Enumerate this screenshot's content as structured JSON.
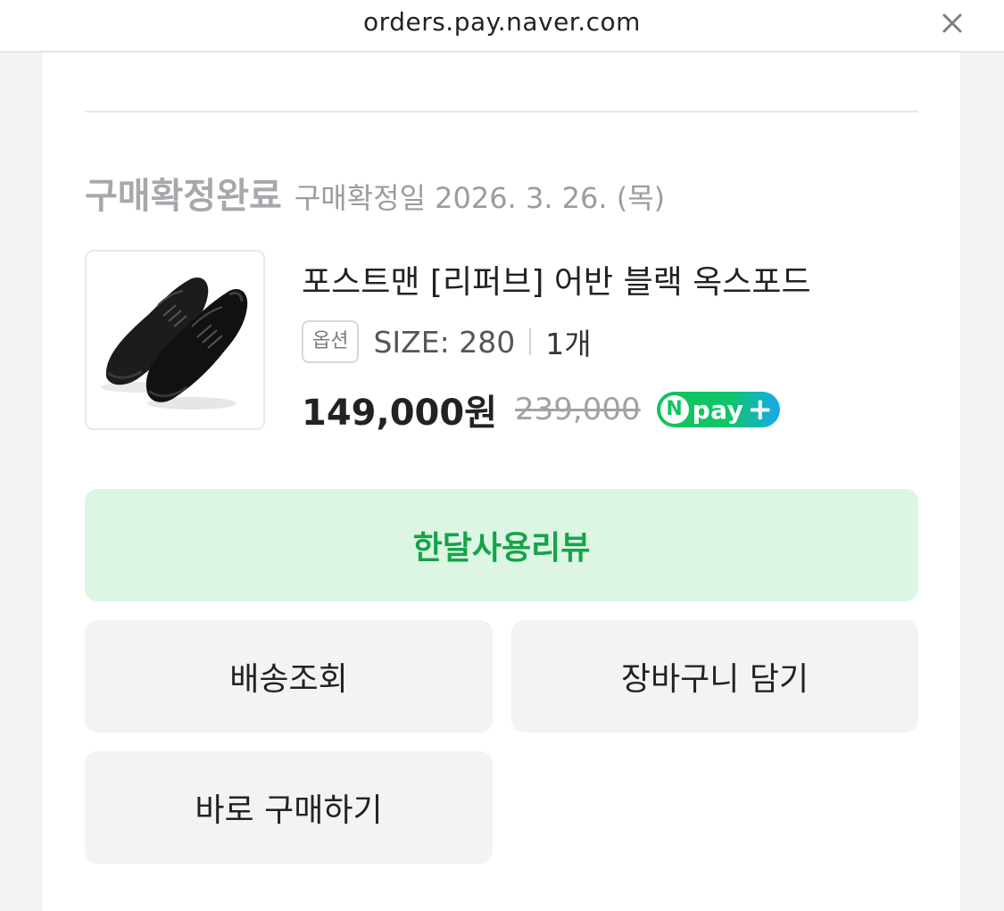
{
  "browser": {
    "url": "orders.pay.naver.com",
    "close_icon": "close-icon"
  },
  "order": {
    "status": "구매확정완료",
    "confirm_date": "구매확정일 2026. 3. 26. (목)",
    "product": {
      "name": "포스트맨 [리퍼브] 어반 블랙 옥스포드",
      "image_icon": "black-oxford-shoes-image",
      "option_label": "옵션",
      "option_value": "SIZE: 280",
      "quantity": "1개",
      "price": "149,000원",
      "original_price": "239,000",
      "badge": {
        "n": "N",
        "text": "pay",
        "plus": "+"
      }
    }
  },
  "actions": {
    "review": "한달사용리뷰",
    "delivery": "배송조회",
    "cart": "장바구니 담기",
    "buy_now": "바로 구매하기"
  },
  "colors": {
    "review_bg": "#dcf6e3",
    "review_text": "#16a34a",
    "npay_green": "#10c45c",
    "npay_blue": "#17a9ef"
  }
}
